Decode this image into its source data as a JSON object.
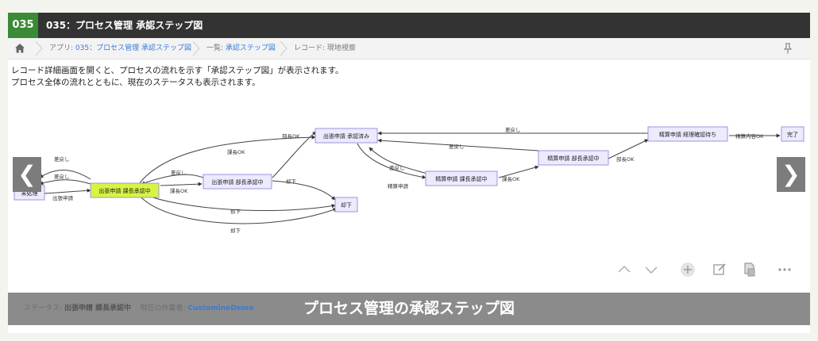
{
  "header": {
    "badge": "035",
    "title": "035：プロセス管理 承認ステップ図"
  },
  "breadcrumb": {
    "app_prefix": "アプリ: ",
    "app_link": "035：プロセス管理 承認ステップ図",
    "list_prefix": "一覧: ",
    "list_link": "承認ステップ図",
    "record": "レコード: 現地視察"
  },
  "description": {
    "line1": "レコード詳細画面を開くと、プロセスの流れを示す「承認ステップ図」が表示されます。",
    "line2": "プロセス全体の流れとともに、現在のステータスも表示されます。"
  },
  "diagram": {
    "nodes": {
      "unprocessed": "未処理",
      "dept_chief": "出張申請 課長承認中",
      "dept_head": "出張申請 部長承認中",
      "approved": "出張申請 承認済み",
      "rejected": "却下",
      "exp_chief": "精算申請 課長承認中",
      "exp_head": "精算申請 部長承認中",
      "exp_accounting": "精算申請 経理確認待ち",
      "done": "完了"
    },
    "edges": {
      "sashimodoshi": "差戻し",
      "shutcho_shinsei": "出張申請",
      "kachou_ok": "課長OK",
      "buchou_ok": "部長OK",
      "kyakka": "却下",
      "seisan_shinsei": "精算申請",
      "seisan_ok": "精算内容OK"
    },
    "colors": {
      "current_node": "#d6f542",
      "node_fill": "#eceaff",
      "node_border": "#9b95d8"
    }
  },
  "status": {
    "status_label": "ステータス: ",
    "status_value": "出張申請 課長承認中",
    "assignee_label": "現在の作業者: ",
    "assignee_value": "CustomineDemo",
    "caption": "プロセス管理の承認ステップ図"
  },
  "icons": {
    "home": "home-icon",
    "pin": "pin-icon",
    "prev": "chevron-left-icon",
    "next": "chevron-right-icon"
  },
  "nav": {
    "prev_glyph": "❮",
    "next_glyph": "❯"
  }
}
